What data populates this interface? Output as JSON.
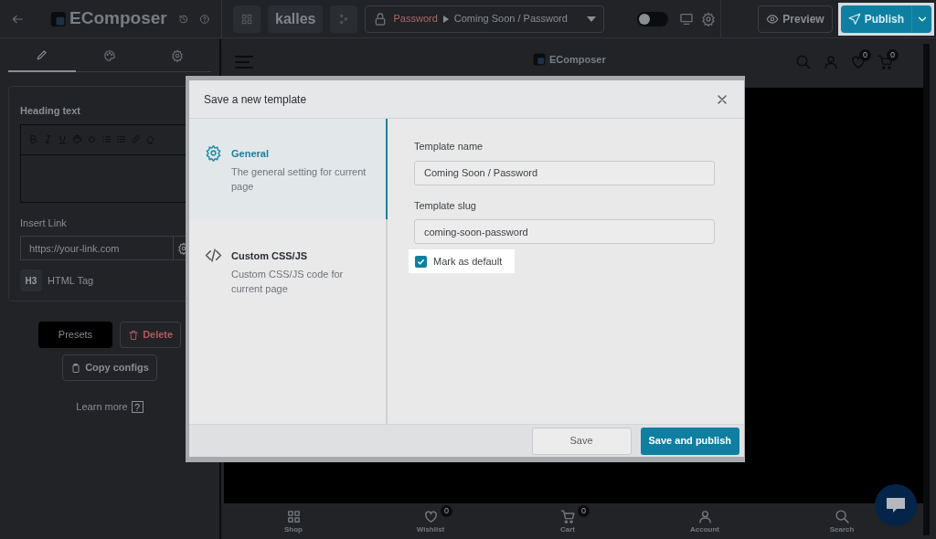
{
  "topbar": {
    "brand": "EComposer",
    "theme": "kalles",
    "breadcrumb": [
      "Password",
      "Coming Soon / Password"
    ],
    "toggle_on": false,
    "preview": "Preview",
    "publish": "Publish"
  },
  "sidebar": {
    "tabs": [
      {
        "kind": "edit",
        "selected": true
      },
      {
        "kind": "style",
        "selected": false
      },
      {
        "kind": "settings",
        "selected": false
      }
    ],
    "heading_label": "Heading text",
    "link_label": "Insert Link",
    "link_placeholder": "https://your-link.com",
    "tag_badge": "H3",
    "tag_label": "HTML Tag",
    "presets": "Presets",
    "delete": "Delete",
    "copy_configs": "Copy configs",
    "learn_more": "Learn more",
    "help_mark": "?"
  },
  "canvas": {
    "logo": "EComposer",
    "wishlist_count": "0",
    "cart_count": "0",
    "bottom_nav": [
      {
        "kind": "shop",
        "label": "Shop"
      },
      {
        "kind": "wishlist",
        "label": "Wishlist",
        "count": "0"
      },
      {
        "kind": "cart",
        "label": "Cart",
        "count": "0"
      },
      {
        "kind": "account",
        "label": "Account"
      },
      {
        "kind": "search",
        "label": "Search"
      }
    ]
  },
  "modal": {
    "title": "Save a new template",
    "sections": [
      {
        "kind": "general",
        "title": "General",
        "description": "The general setting for current page",
        "selected": true
      },
      {
        "kind": "code",
        "title": "Custom CSS/JS",
        "description": "Custom CSS/JS code for current page",
        "selected": false
      }
    ],
    "fields": [
      {
        "label": "Template name",
        "value": "Coming Soon / Password"
      },
      {
        "label": "Template slug",
        "value": "coming-soon-password"
      }
    ],
    "mark_default": {
      "label": "Mark as default",
      "checked": true
    },
    "buttons": [
      {
        "kind": "secondary",
        "label": "Save"
      },
      {
        "kind": "primary",
        "label": "Save and publish"
      }
    ]
  }
}
